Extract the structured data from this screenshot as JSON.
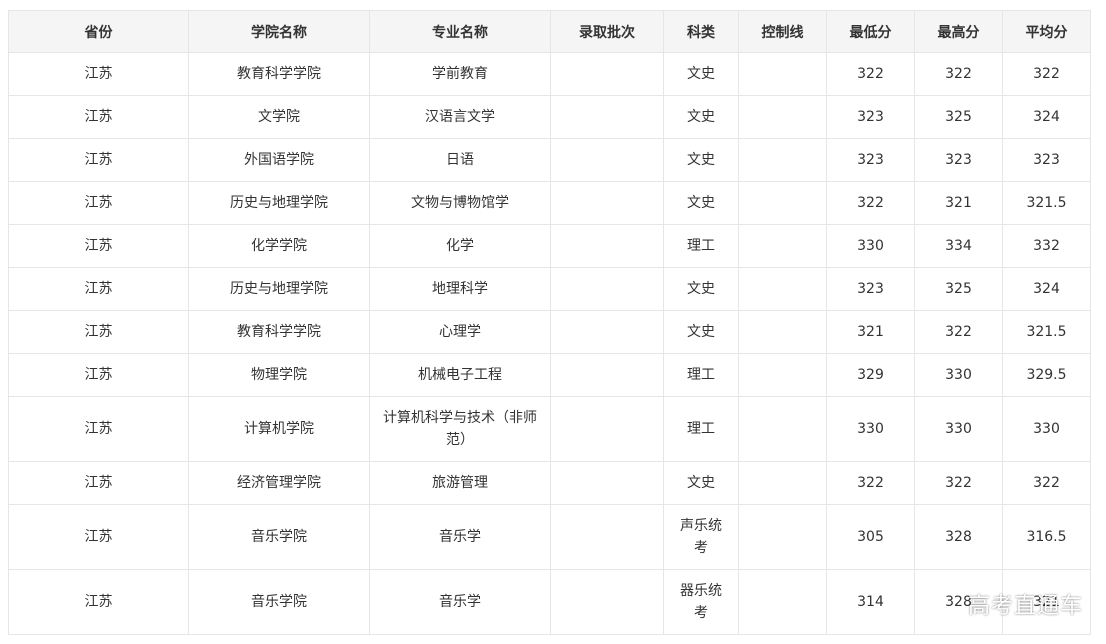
{
  "table": {
    "headers": [
      "省份",
      "学院名称",
      "专业名称",
      "录取批次",
      "科类",
      "控制线",
      "最低分",
      "最高分",
      "平均分"
    ],
    "rows": [
      [
        "江苏",
        "教育科学学院",
        "学前教育",
        "",
        "文史",
        "",
        "322",
        "322",
        "322"
      ],
      [
        "江苏",
        "文学院",
        "汉语言文学",
        "",
        "文史",
        "",
        "323",
        "325",
        "324"
      ],
      [
        "江苏",
        "外国语学院",
        "日语",
        "",
        "文史",
        "",
        "323",
        "323",
        "323"
      ],
      [
        "江苏",
        "历史与地理学院",
        "文物与博物馆学",
        "",
        "文史",
        "",
        "322",
        "321",
        "321.5"
      ],
      [
        "江苏",
        "化学学院",
        "化学",
        "",
        "理工",
        "",
        "330",
        "334",
        "332"
      ],
      [
        "江苏",
        "历史与地理学院",
        "地理科学",
        "",
        "文史",
        "",
        "323",
        "325",
        "324"
      ],
      [
        "江苏",
        "教育科学学院",
        "心理学",
        "",
        "文史",
        "",
        "321",
        "322",
        "321.5"
      ],
      [
        "江苏",
        "物理学院",
        "机械电子工程",
        "",
        "理工",
        "",
        "329",
        "330",
        "329.5"
      ],
      [
        "江苏",
        "计算机学院",
        "计算机科学与技术（非师范）",
        "",
        "理工",
        "",
        "330",
        "330",
        "330"
      ],
      [
        "江苏",
        "经济管理学院",
        "旅游管理",
        "",
        "文史",
        "",
        "322",
        "322",
        "322"
      ],
      [
        "江苏",
        "音乐学院",
        "音乐学",
        "",
        "声乐统考",
        "",
        "305",
        "328",
        "316.5"
      ],
      [
        "江苏",
        "音乐学院",
        "音乐学",
        "",
        "器乐统考",
        "",
        "314",
        "328",
        "321"
      ]
    ]
  },
  "watermark": "高考直通车"
}
